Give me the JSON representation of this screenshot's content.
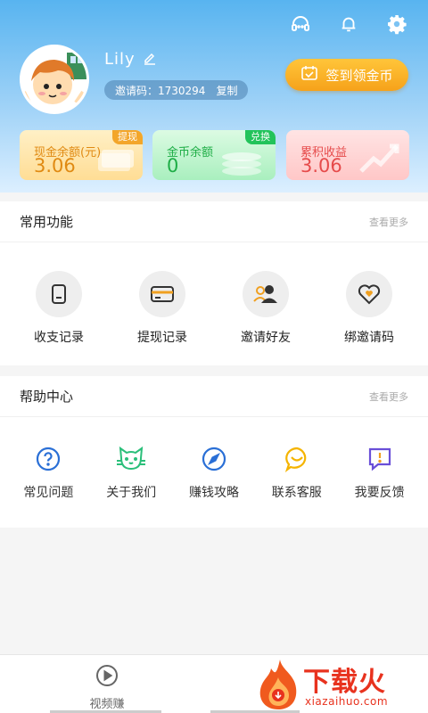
{
  "header": {
    "icons": [
      "headset-icon",
      "bell-icon",
      "gear-icon"
    ],
    "username": "Lily",
    "invite_label": "邀请码：1730294",
    "copy_label": "复制",
    "checkin_label": "签到领金币"
  },
  "cards": {
    "cash": {
      "label": "现金余额(元)",
      "value": "3.06",
      "tag": "提现"
    },
    "coin": {
      "label": "金币余额",
      "value": "0",
      "tag": "兑换"
    },
    "earn": {
      "label": "累积收益",
      "value": "3.06"
    }
  },
  "common": {
    "title": "常用功能",
    "more": "查看更多",
    "items": [
      {
        "label": "收支记录",
        "icon": "receipt-icon"
      },
      {
        "label": "提现记录",
        "icon": "card-icon"
      },
      {
        "label": "邀请好友",
        "icon": "friends-icon"
      },
      {
        "label": "绑邀请码",
        "icon": "heart-bind-icon"
      }
    ]
  },
  "help": {
    "title": "帮助中心",
    "more": "查看更多",
    "items": [
      {
        "label": "常见问题",
        "icon": "question-icon",
        "color": "#2a6fd6"
      },
      {
        "label": "关于我们",
        "icon": "cat-icon",
        "color": "#2bbf7a"
      },
      {
        "label": "赚钱攻略",
        "icon": "compass-icon",
        "color": "#2a6fd6"
      },
      {
        "label": "联系客服",
        "icon": "smile-chat-icon",
        "color": "#f5b400"
      },
      {
        "label": "我要反馈",
        "icon": "feedback-icon",
        "color": "#6a4fd8"
      }
    ]
  },
  "tabbar": {
    "video_label": "视频赚"
  },
  "watermark": {
    "title": "下载火",
    "sub": "xiazaihuo.com"
  }
}
